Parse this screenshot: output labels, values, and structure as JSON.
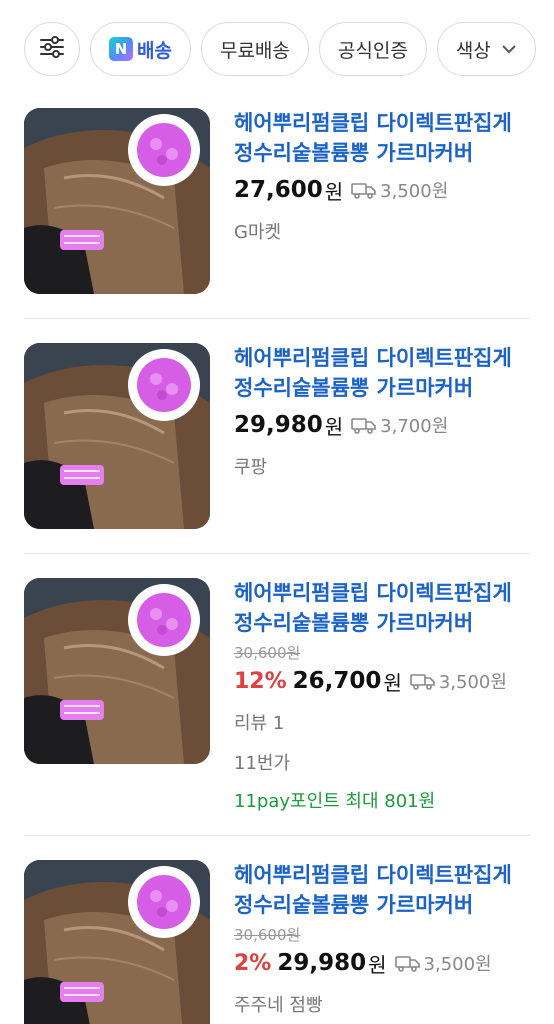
{
  "filters": {
    "settings_icon": "sliders-icon",
    "n_delivery": {
      "badge": "N",
      "label": "배송"
    },
    "free_shipping": "무료배송",
    "official": "공식인증",
    "color": "색상"
  },
  "products": [
    {
      "title": "헤어뿌리펌클립 다이렉트판집게 정수리숱볼륨뽕 가르마커버",
      "price": "27,600",
      "won": "원",
      "shipping": "3,500원",
      "seller": "G마켓"
    },
    {
      "title": "헤어뿌리펌클립 다이렉트판집게 정수리숱볼륨뽕 가르마커버",
      "price": "29,980",
      "won": "원",
      "shipping": "3,700원",
      "seller": "쿠팡"
    },
    {
      "title": "헤어뿌리펌클립 다이렉트판집게 정수리숱볼륨뽕 가르마커버",
      "original_price": "30,600원",
      "discount": "12%",
      "price": "26,700",
      "won": "원",
      "shipping": "3,500원",
      "review": "리뷰 1",
      "seller": "11번가",
      "point": "11pay포인트 최대 801원"
    },
    {
      "title": "헤어뿌리펌클립 다이렉트판집게 정수리숱볼륨뽕 가르마커버",
      "original_price": "30,600원",
      "discount": "2%",
      "price": "29,980",
      "won": "원",
      "shipping": "3,500원",
      "seller": "주주네 점빵"
    }
  ],
  "colors": {
    "title_blue": "#1b63c8",
    "discount_red": "#e0403f",
    "point_green": "#1a9c3a"
  }
}
